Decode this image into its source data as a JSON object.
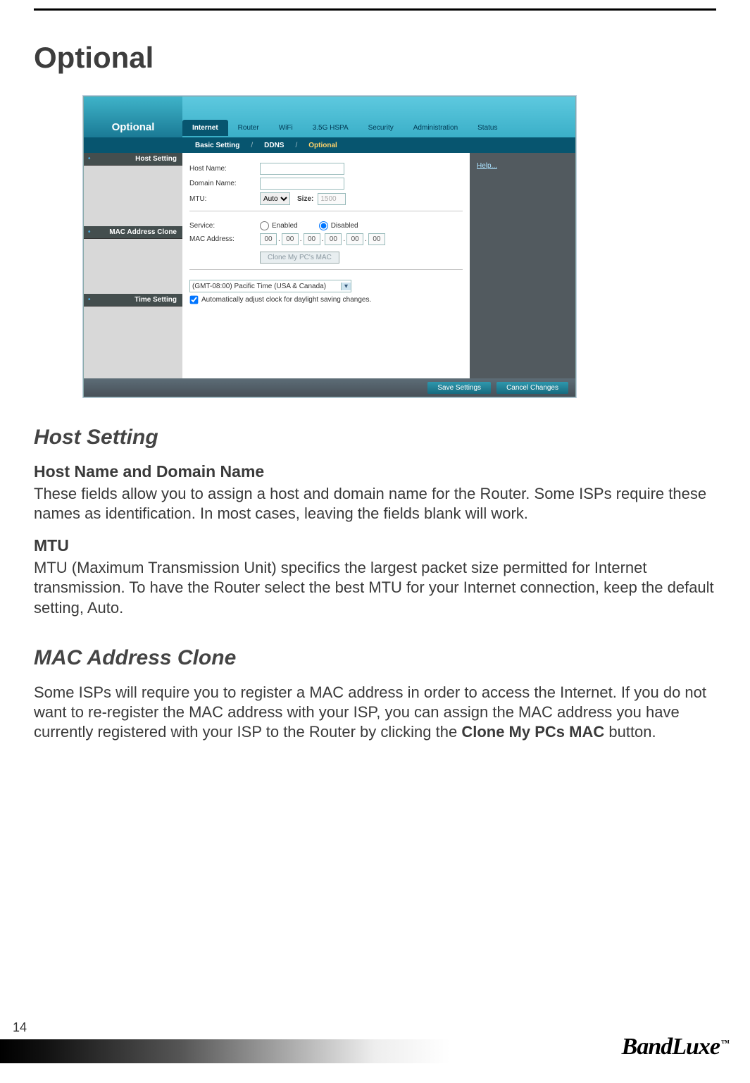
{
  "page": {
    "title": "Optional",
    "number": "14",
    "brand": "BandLuxe",
    "tm": "™"
  },
  "ui": {
    "header_left": "Optional",
    "tabs": [
      "Internet",
      "Router",
      "WiFi",
      "3.5G HSPA",
      "Security",
      "Administration",
      "Status"
    ],
    "subnav": {
      "a": "Basic Setting",
      "b": "DDNS",
      "c": "Optional"
    },
    "help": "Help...",
    "sections": {
      "host": {
        "title": "Host Setting",
        "host_name_label": "Host Name:",
        "domain_name_label": "Domain Name:",
        "mtu_label": "MTU:",
        "mtu_mode": "Auto",
        "size_label": "Size:",
        "size_value": "1500"
      },
      "mac": {
        "title": "MAC Address Clone",
        "service_label": "Service:",
        "enabled": "Enabled",
        "disabled": "Disabled",
        "mac_label": "MAC Address:",
        "oct": "00",
        "clone_btn": "Clone My PC's MAC"
      },
      "time": {
        "title": "Time Setting",
        "tz": "(GMT-08:00) Pacific Time (USA & Canada)",
        "dst": "Automatically adjust clock for daylight saving changes."
      }
    },
    "buttons": {
      "save": "Save Settings",
      "cancel": "Cancel Changes"
    }
  },
  "doc": {
    "h2a": "Host Setting",
    "h3a": "Host Name and Domain Name",
    "p1": "These fields allow you to assign a host and domain name for the Router. Some ISPs require these names as identification. In most cases, leaving the fields blank will work.",
    "h3b": "MTU",
    "p2": "MTU (Maximum Transmission Unit) specifics the largest packet size permitted for Internet transmission. To have the Router select the best MTU for your Internet connection, keep the default setting, Auto.",
    "h2b": "MAC Address Clone",
    "p3a": "Some ISPs will require you to register a MAC address in order to access the Internet. If you do not want to re-register the MAC address with your ISP, you can assign the MAC address you have currently registered with your ISP to the Router by clicking the ",
    "p3b": "Clone My PCs MAC",
    "p3c": " button."
  }
}
